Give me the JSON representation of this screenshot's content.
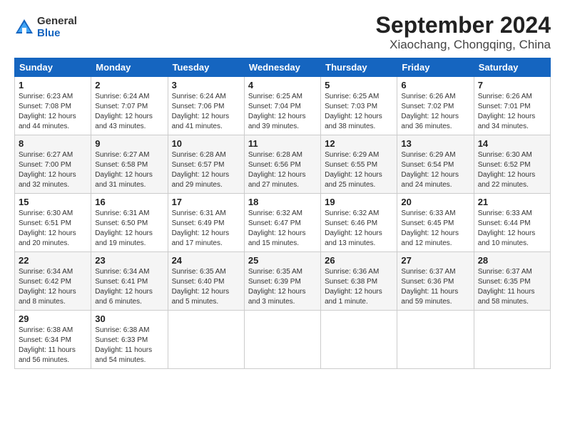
{
  "header": {
    "logo_general": "General",
    "logo_blue": "Blue",
    "title": "September 2024",
    "subtitle": "Xiaochang, Chongqing, China"
  },
  "calendar": {
    "days_of_week": [
      "Sunday",
      "Monday",
      "Tuesday",
      "Wednesday",
      "Thursday",
      "Friday",
      "Saturday"
    ],
    "weeks": [
      [
        {
          "day": "1",
          "info": "Sunrise: 6:23 AM\nSunset: 7:08 PM\nDaylight: 12 hours\nand 44 minutes."
        },
        {
          "day": "2",
          "info": "Sunrise: 6:24 AM\nSunset: 7:07 PM\nDaylight: 12 hours\nand 43 minutes."
        },
        {
          "day": "3",
          "info": "Sunrise: 6:24 AM\nSunset: 7:06 PM\nDaylight: 12 hours\nand 41 minutes."
        },
        {
          "day": "4",
          "info": "Sunrise: 6:25 AM\nSunset: 7:04 PM\nDaylight: 12 hours\nand 39 minutes."
        },
        {
          "day": "5",
          "info": "Sunrise: 6:25 AM\nSunset: 7:03 PM\nDaylight: 12 hours\nand 38 minutes."
        },
        {
          "day": "6",
          "info": "Sunrise: 6:26 AM\nSunset: 7:02 PM\nDaylight: 12 hours\nand 36 minutes."
        },
        {
          "day": "7",
          "info": "Sunrise: 6:26 AM\nSunset: 7:01 PM\nDaylight: 12 hours\nand 34 minutes."
        }
      ],
      [
        {
          "day": "8",
          "info": "Sunrise: 6:27 AM\nSunset: 7:00 PM\nDaylight: 12 hours\nand 32 minutes."
        },
        {
          "day": "9",
          "info": "Sunrise: 6:27 AM\nSunset: 6:58 PM\nDaylight: 12 hours\nand 31 minutes."
        },
        {
          "day": "10",
          "info": "Sunrise: 6:28 AM\nSunset: 6:57 PM\nDaylight: 12 hours\nand 29 minutes."
        },
        {
          "day": "11",
          "info": "Sunrise: 6:28 AM\nSunset: 6:56 PM\nDaylight: 12 hours\nand 27 minutes."
        },
        {
          "day": "12",
          "info": "Sunrise: 6:29 AM\nSunset: 6:55 PM\nDaylight: 12 hours\nand 25 minutes."
        },
        {
          "day": "13",
          "info": "Sunrise: 6:29 AM\nSunset: 6:54 PM\nDaylight: 12 hours\nand 24 minutes."
        },
        {
          "day": "14",
          "info": "Sunrise: 6:30 AM\nSunset: 6:52 PM\nDaylight: 12 hours\nand 22 minutes."
        }
      ],
      [
        {
          "day": "15",
          "info": "Sunrise: 6:30 AM\nSunset: 6:51 PM\nDaylight: 12 hours\nand 20 minutes."
        },
        {
          "day": "16",
          "info": "Sunrise: 6:31 AM\nSunset: 6:50 PM\nDaylight: 12 hours\nand 19 minutes."
        },
        {
          "day": "17",
          "info": "Sunrise: 6:31 AM\nSunset: 6:49 PM\nDaylight: 12 hours\nand 17 minutes."
        },
        {
          "day": "18",
          "info": "Sunrise: 6:32 AM\nSunset: 6:47 PM\nDaylight: 12 hours\nand 15 minutes."
        },
        {
          "day": "19",
          "info": "Sunrise: 6:32 AM\nSunset: 6:46 PM\nDaylight: 12 hours\nand 13 minutes."
        },
        {
          "day": "20",
          "info": "Sunrise: 6:33 AM\nSunset: 6:45 PM\nDaylight: 12 hours\nand 12 minutes."
        },
        {
          "day": "21",
          "info": "Sunrise: 6:33 AM\nSunset: 6:44 PM\nDaylight: 12 hours\nand 10 minutes."
        }
      ],
      [
        {
          "day": "22",
          "info": "Sunrise: 6:34 AM\nSunset: 6:42 PM\nDaylight: 12 hours\nand 8 minutes."
        },
        {
          "day": "23",
          "info": "Sunrise: 6:34 AM\nSunset: 6:41 PM\nDaylight: 12 hours\nand 6 minutes."
        },
        {
          "day": "24",
          "info": "Sunrise: 6:35 AM\nSunset: 6:40 PM\nDaylight: 12 hours\nand 5 minutes."
        },
        {
          "day": "25",
          "info": "Sunrise: 6:35 AM\nSunset: 6:39 PM\nDaylight: 12 hours\nand 3 minutes."
        },
        {
          "day": "26",
          "info": "Sunrise: 6:36 AM\nSunset: 6:38 PM\nDaylight: 12 hours\nand 1 minute."
        },
        {
          "day": "27",
          "info": "Sunrise: 6:37 AM\nSunset: 6:36 PM\nDaylight: 11 hours\nand 59 minutes."
        },
        {
          "day": "28",
          "info": "Sunrise: 6:37 AM\nSunset: 6:35 PM\nDaylight: 11 hours\nand 58 minutes."
        }
      ],
      [
        {
          "day": "29",
          "info": "Sunrise: 6:38 AM\nSunset: 6:34 PM\nDaylight: 11 hours\nand 56 minutes."
        },
        {
          "day": "30",
          "info": "Sunrise: 6:38 AM\nSunset: 6:33 PM\nDaylight: 11 hours\nand 54 minutes."
        },
        {
          "day": "",
          "info": ""
        },
        {
          "day": "",
          "info": ""
        },
        {
          "day": "",
          "info": ""
        },
        {
          "day": "",
          "info": ""
        },
        {
          "day": "",
          "info": ""
        }
      ]
    ]
  }
}
